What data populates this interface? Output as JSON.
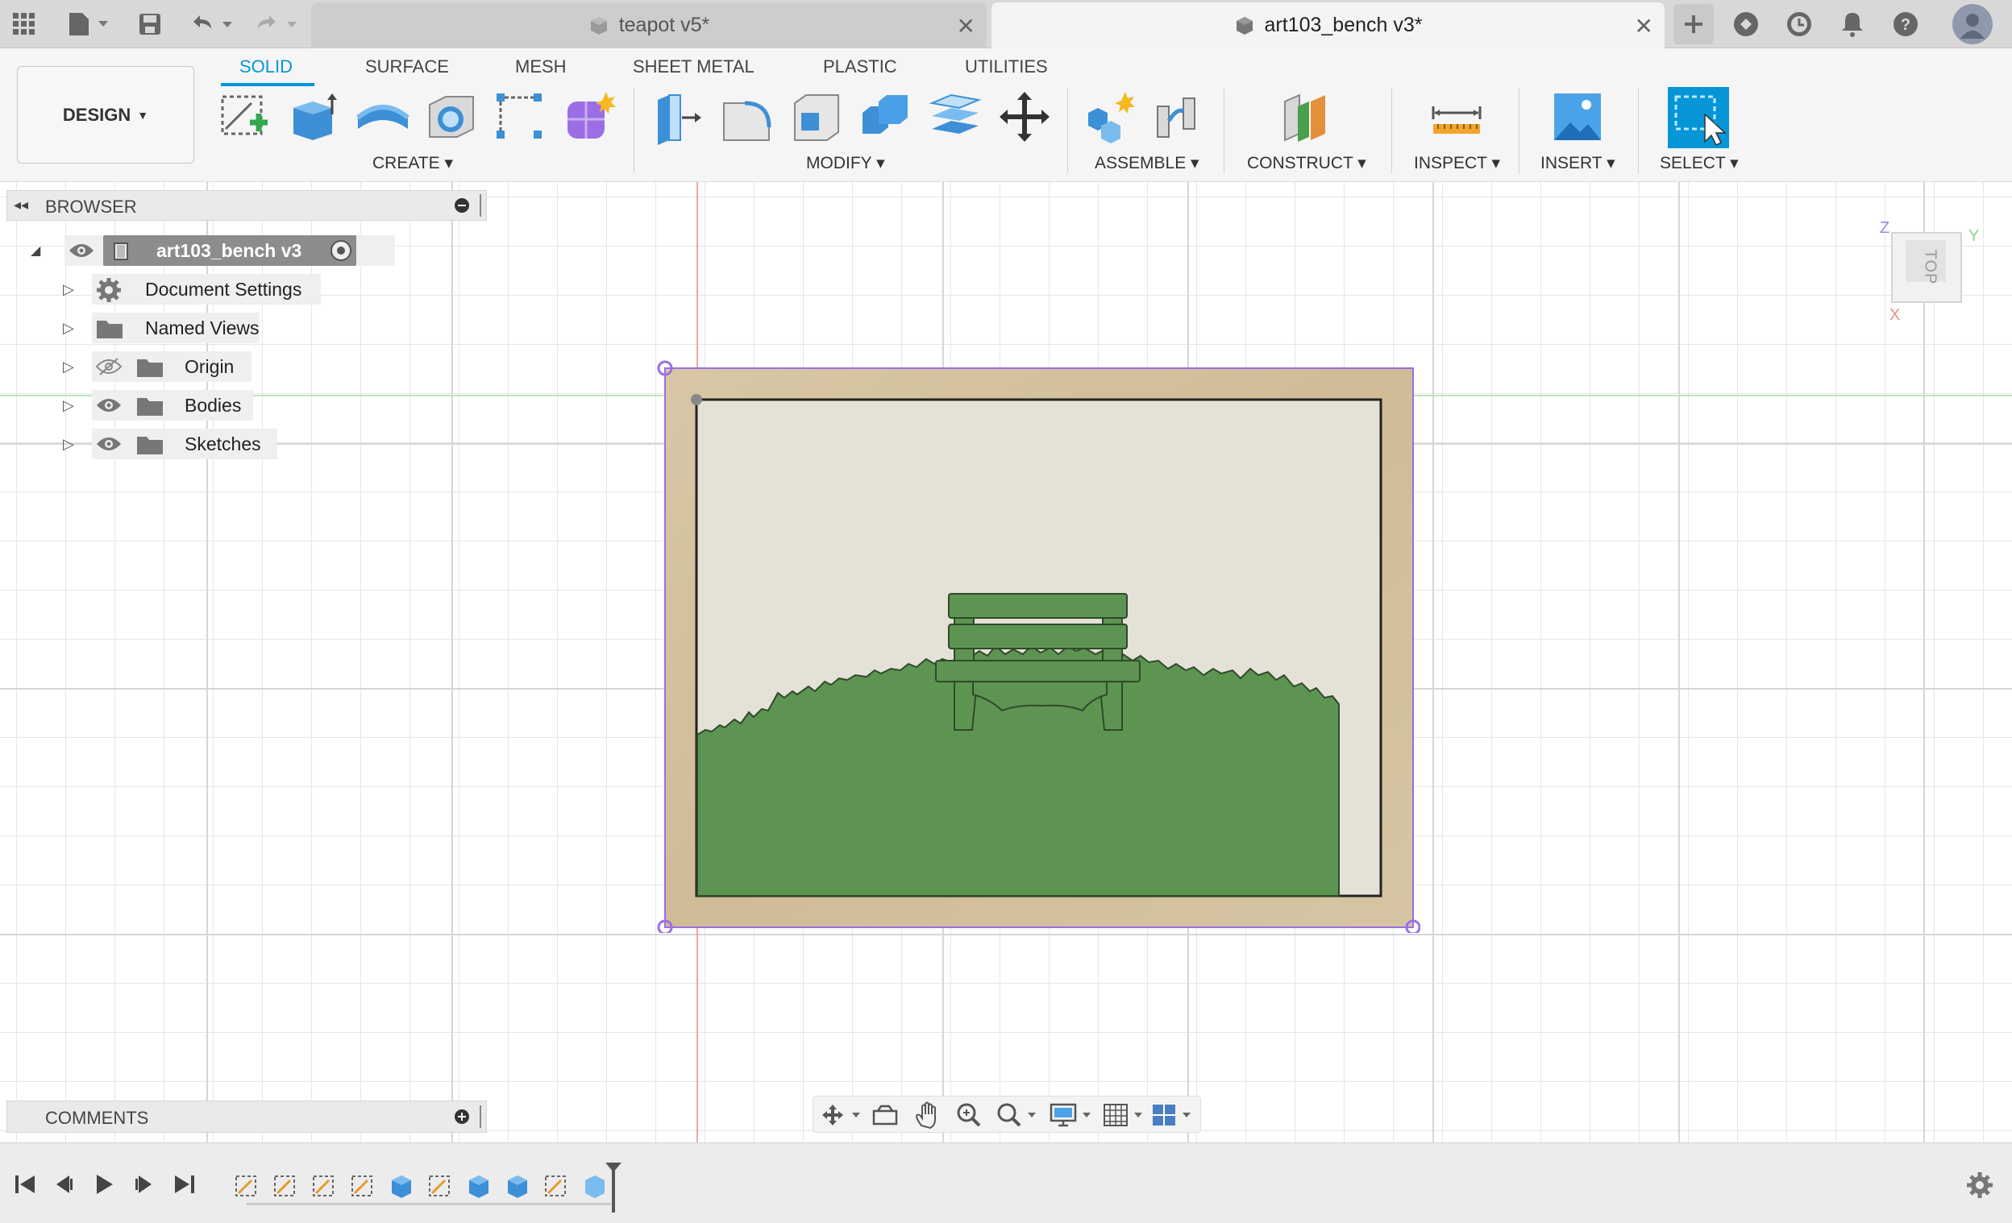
{
  "tabs": {
    "inactive_title": "teapot v5*",
    "active_title": "art103_bench v3*"
  },
  "ribbon": {
    "tabs": [
      "SOLID",
      "SURFACE",
      "MESH",
      "SHEET METAL",
      "PLASTIC",
      "UTILITIES"
    ],
    "active_tab": "SOLID",
    "workspace_label": "DESIGN",
    "groups": [
      "CREATE",
      "MODIFY",
      "ASSEMBLE",
      "CONSTRUCT",
      "INSPECT",
      "INSERT",
      "SELECT"
    ]
  },
  "browser": {
    "title": "BROWSER",
    "root": "art103_bench v3",
    "items": [
      "Document Settings",
      "Named Views",
      "Origin",
      "Bodies",
      "Sketches"
    ]
  },
  "comments": {
    "title": "COMMENTS"
  },
  "viewcube": {
    "face": "TOP",
    "axis_z": "Z",
    "axis_y": "Y",
    "axis_x": "X"
  },
  "colors": {
    "accent": "#0696d7",
    "frame": "#d3c19f",
    "backdrop": "#e4e1d6",
    "grass": "#5e9451",
    "selection": "#9b6ee6"
  },
  "icons": {
    "apps": "grid-icon",
    "file": "file-icon",
    "save": "save-icon",
    "undo": "undo-icon",
    "redo": "redo-icon"
  }
}
